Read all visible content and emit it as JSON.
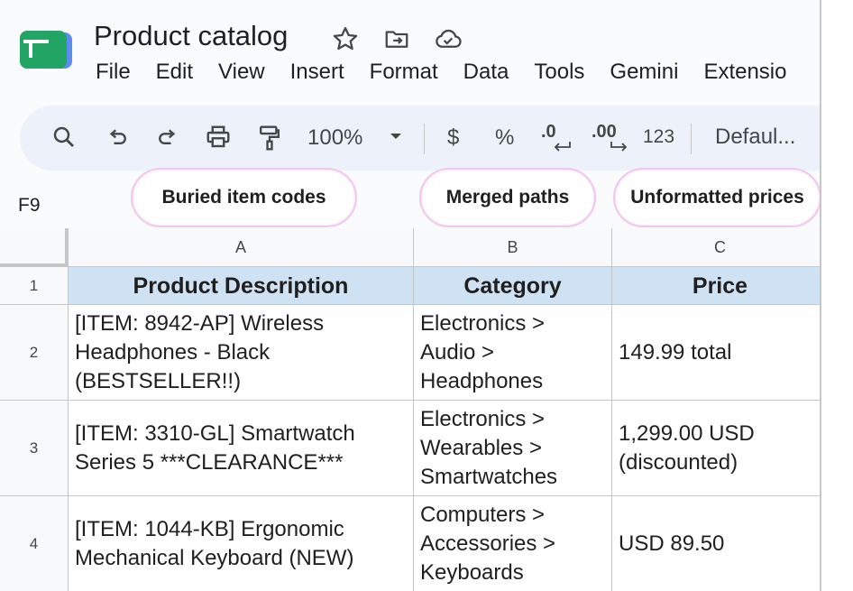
{
  "doc": {
    "title": "Product catalog",
    "icons": [
      "star-icon",
      "move-to-folder-icon",
      "cloud-saved-icon"
    ]
  },
  "menu": [
    "File",
    "Edit",
    "View",
    "Insert",
    "Format",
    "Data",
    "Tools",
    "Gemini",
    "Extensio"
  ],
  "toolbar": {
    "zoom": "100%",
    "currency": "$",
    "percent": "%",
    "decrease_decimal": ".0",
    "increase_decimal": ".00",
    "number_format": "123",
    "font": "Defaul..."
  },
  "callouts": [
    "Buried item codes",
    "Merged paths",
    "Unformatted prices"
  ],
  "namebox": "F9",
  "columns": [
    "A",
    "B",
    "C"
  ],
  "rows": [
    {
      "num": "1",
      "cells": [
        "Product Description",
        "Category",
        "Price"
      ]
    },
    {
      "num": "2",
      "cells": [
        "[ITEM: 8942-AP] Wireless\nHeadphones - Black\n(BESTSELLER!!)",
        "Electronics >\nAudio >\nHeadphones",
        "149.99 total"
      ]
    },
    {
      "num": "3",
      "cells": [
        "[ITEM: 3310-GL] Smartwatch\nSeries 5 ***CLEARANCE***",
        "Electronics >\nWearables >\nSmartwatches",
        "1,299.00 USD\n(discounted)"
      ]
    },
    {
      "num": "4",
      "cells": [
        "[ITEM: 1044-KB] Ergonomic\nMechanical Keyboard (NEW)",
        "Computers >\nAccessories >\nKeyboards",
        "USD 89.50"
      ]
    }
  ],
  "colors": {
    "header_fill": "#cfe2f3",
    "toolbar_bg": "#edf2fa",
    "callout_border": "#f2c7ef",
    "logo_green": "#0f9d58"
  }
}
